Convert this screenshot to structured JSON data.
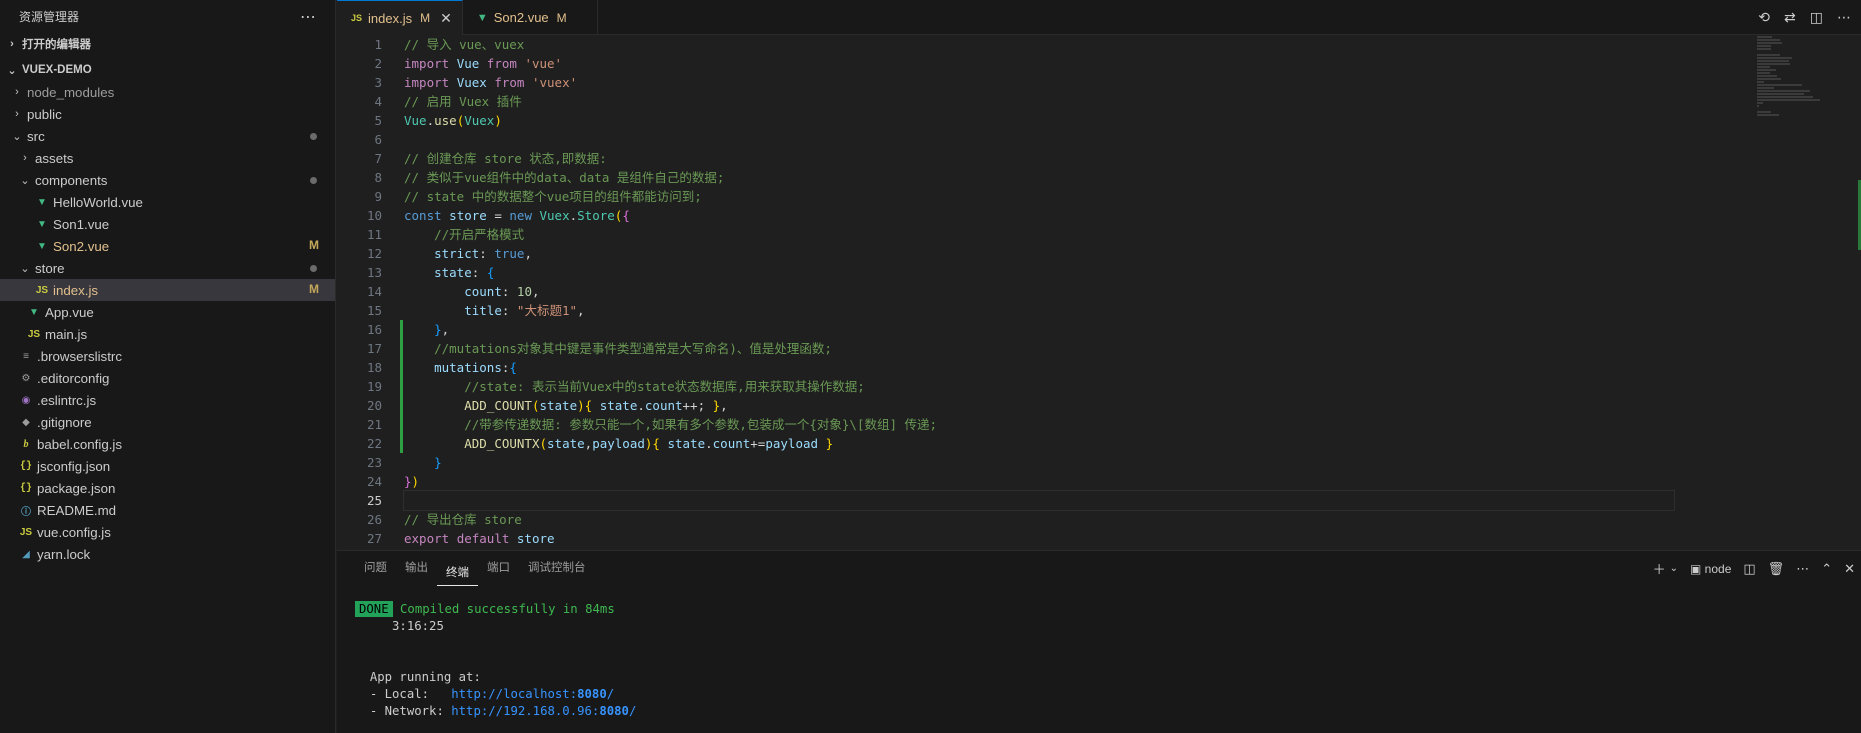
{
  "sidebar": {
    "title": "资源管理器",
    "more_icon": "⋯",
    "open_editors": "打开的编辑器",
    "project": "VUEX-DEMO",
    "items": [
      {
        "label": "node_modules",
        "depth": 1,
        "chevron": "›",
        "icon": ""
      },
      {
        "label": "public",
        "depth": 1,
        "chevron": "›",
        "icon": ""
      },
      {
        "label": "src",
        "depth": 1,
        "chevron": "⌄",
        "icon": ""
      },
      {
        "label": "assets",
        "depth": 2,
        "chevron": "›",
        "icon": ""
      },
      {
        "label": "components",
        "depth": 2,
        "chevron": "⌄",
        "icon": ""
      },
      {
        "label": "HelloWorld.vue",
        "depth": 3,
        "icon": "vue"
      },
      {
        "label": "Son1.vue",
        "depth": 3,
        "icon": "vue"
      },
      {
        "label": "Son2.vue",
        "depth": 3,
        "icon": "vue",
        "status": "M"
      },
      {
        "label": "store",
        "depth": 2,
        "chevron": "⌄",
        "icon": ""
      },
      {
        "label": "index.js",
        "depth": 3,
        "icon": "js",
        "status": "M"
      },
      {
        "label": "App.vue",
        "depth": 2,
        "icon": "vue"
      },
      {
        "label": "main.js",
        "depth": 2,
        "icon": "js"
      },
      {
        "label": ".browserslistrc",
        "depth": 1,
        "icon": "list"
      },
      {
        "label": ".editorconfig",
        "depth": 1,
        "icon": "gear"
      },
      {
        "label": ".eslintrc.js",
        "depth": 1,
        "icon": "eslint"
      },
      {
        "label": ".gitignore",
        "depth": 1,
        "icon": "git"
      },
      {
        "label": "babel.config.js",
        "depth": 1,
        "icon": "babel"
      },
      {
        "label": "jsconfig.json",
        "depth": 1,
        "icon": "json"
      },
      {
        "label": "package.json",
        "depth": 1,
        "icon": "json"
      },
      {
        "label": "README.md",
        "depth": 1,
        "icon": "info"
      },
      {
        "label": "vue.config.js",
        "depth": 1,
        "icon": "js"
      },
      {
        "label": "yarn.lock",
        "depth": 1,
        "icon": "yarn"
      }
    ]
  },
  "tabs": [
    {
      "name": "index.js",
      "status": "M",
      "icon": "JS",
      "active": true
    },
    {
      "name": "Son2.vue",
      "status": "M",
      "icon": "V",
      "active": false
    }
  ],
  "editor": {
    "current_line": 25,
    "lines": [
      [
        [
          "k-com",
          "// 导入 vue、vuex"
        ]
      ],
      [
        [
          "k-kw",
          "import"
        ],
        [
          "k-white",
          " "
        ],
        [
          "k-var",
          "Vue"
        ],
        [
          "k-white",
          " "
        ],
        [
          "k-kw",
          "from"
        ],
        [
          "k-white",
          " "
        ],
        [
          "k-str",
          "'vue'"
        ]
      ],
      [
        [
          "k-kw",
          "import"
        ],
        [
          "k-white",
          " "
        ],
        [
          "k-var",
          "Vuex"
        ],
        [
          "k-white",
          " "
        ],
        [
          "k-kw",
          "from"
        ],
        [
          "k-white",
          " "
        ],
        [
          "k-str",
          "'vuex'"
        ]
      ],
      [
        [
          "k-com",
          "// 启用 Vuex 插件"
        ]
      ],
      [
        [
          "k-cls",
          "Vue"
        ],
        [
          "k-white",
          "."
        ],
        [
          "k-fn",
          "use"
        ],
        [
          "k-br1",
          "("
        ],
        [
          "k-cls",
          "Vuex"
        ],
        [
          "k-br1",
          ")"
        ]
      ],
      [],
      [
        [
          "k-com",
          "// 创建仓库 store 状态,即数据:"
        ]
      ],
      [
        [
          "k-com",
          "// 类似于vue组件中的data、data 是组件自己的数据;"
        ]
      ],
      [
        [
          "k-com",
          "// state 中的数据整个vue项目的组件都能访问到;"
        ]
      ],
      [
        [
          "k-kw2",
          "const"
        ],
        [
          "k-white",
          " "
        ],
        [
          "k-var",
          "store"
        ],
        [
          "k-white",
          " = "
        ],
        [
          "k-kw2",
          "new"
        ],
        [
          "k-white",
          " "
        ],
        [
          "k-cls",
          "Vuex"
        ],
        [
          "k-white",
          "."
        ],
        [
          "k-cls",
          "Store"
        ],
        [
          "k-br1",
          "("
        ],
        [
          "k-br2",
          "{"
        ]
      ],
      [
        [
          "k-white",
          "    "
        ],
        [
          "k-com",
          "//开启严格模式"
        ]
      ],
      [
        [
          "k-white",
          "    "
        ],
        [
          "k-var",
          "strict"
        ],
        [
          "k-white",
          ": "
        ],
        [
          "k-kw2",
          "true"
        ],
        [
          "k-white",
          ","
        ]
      ],
      [
        [
          "k-white",
          "    "
        ],
        [
          "k-var",
          "state"
        ],
        [
          "k-white",
          ": "
        ],
        [
          "k-br3",
          "{"
        ]
      ],
      [
        [
          "k-white",
          "        "
        ],
        [
          "k-var",
          "count"
        ],
        [
          "k-white",
          ": "
        ],
        [
          "k-num",
          "10"
        ],
        [
          "k-white",
          ","
        ]
      ],
      [
        [
          "k-white",
          "        "
        ],
        [
          "k-var",
          "title"
        ],
        [
          "k-white",
          ": "
        ],
        [
          "k-str",
          "\"大标题1\""
        ],
        [
          "k-white",
          ","
        ]
      ],
      [
        [
          "k-white",
          "    "
        ],
        [
          "k-br3",
          "}"
        ],
        [
          "k-white",
          ","
        ]
      ],
      [
        [
          "k-white",
          "    "
        ],
        [
          "k-com",
          "//mutations对象其中键是事件类型通常是大写命名)、值是处理函数;"
        ]
      ],
      [
        [
          "k-white",
          "    "
        ],
        [
          "k-var",
          "mutations"
        ],
        [
          "k-white",
          ":"
        ],
        [
          "k-br3",
          "{"
        ]
      ],
      [
        [
          "k-white",
          "        "
        ],
        [
          "k-com",
          "//state: 表示当前Vuex中的state状态数据库,用来获取其操作数据;"
        ]
      ],
      [
        [
          "k-white",
          "        "
        ],
        [
          "k-fn",
          "ADD_COUNT"
        ],
        [
          "k-br1",
          "("
        ],
        [
          "k-var",
          "state"
        ],
        [
          "k-br1",
          ")"
        ],
        [
          "k-br1",
          "{"
        ],
        [
          "k-white",
          " "
        ],
        [
          "k-var",
          "state"
        ],
        [
          "k-white",
          "."
        ],
        [
          "k-var",
          "count"
        ],
        [
          "k-white",
          "++; "
        ],
        [
          "k-br1",
          "}"
        ],
        [
          "k-white",
          ","
        ]
      ],
      [
        [
          "k-white",
          "        "
        ],
        [
          "k-com",
          "//带参传递数据: 参数只能一个,如果有多个参数,包装成一个{对象}\\[数组] 传递;"
        ]
      ],
      [
        [
          "k-white",
          "        "
        ],
        [
          "k-fn",
          "ADD_COUNTX"
        ],
        [
          "k-br1",
          "("
        ],
        [
          "k-var",
          "state"
        ],
        [
          "k-white",
          ","
        ],
        [
          "k-var",
          "payload"
        ],
        [
          "k-br1",
          ")"
        ],
        [
          "k-br1",
          "{"
        ],
        [
          "k-white",
          " "
        ],
        [
          "k-var",
          "state"
        ],
        [
          "k-white",
          "."
        ],
        [
          "k-var",
          "count"
        ],
        [
          "k-white",
          "+="
        ],
        [
          "k-var",
          "payload"
        ],
        [
          "k-white",
          " "
        ],
        [
          "k-br1",
          "}"
        ]
      ],
      [
        [
          "k-white",
          "    "
        ],
        [
          "k-br3",
          "}"
        ]
      ],
      [
        [
          "k-br2",
          "}"
        ],
        [
          "k-br1",
          ")"
        ]
      ],
      [],
      [
        [
          "k-com",
          "// 导出仓库 store"
        ]
      ],
      [
        [
          "k-kw",
          "export"
        ],
        [
          "k-white",
          " "
        ],
        [
          "k-kw",
          "default"
        ],
        [
          "k-white",
          " "
        ],
        [
          "k-var",
          "store"
        ]
      ]
    ]
  },
  "panel": {
    "tabs": [
      "问题",
      "输出",
      "终端",
      "端口",
      "调试控制台"
    ],
    "active_tab": "终端",
    "terminal_name": "node",
    "done_badge": "DONE",
    "compiled": "Compiled successfully in 84ms",
    "time": "3:16:25",
    "running": "App running at:",
    "local_label": "- Local:   ",
    "local_url": "http://localhost:",
    "local_port": "8080",
    "network_label": "- Network: ",
    "network_url": "http://192.168.0.96:",
    "network_port": "8080",
    "slash": "/"
  }
}
